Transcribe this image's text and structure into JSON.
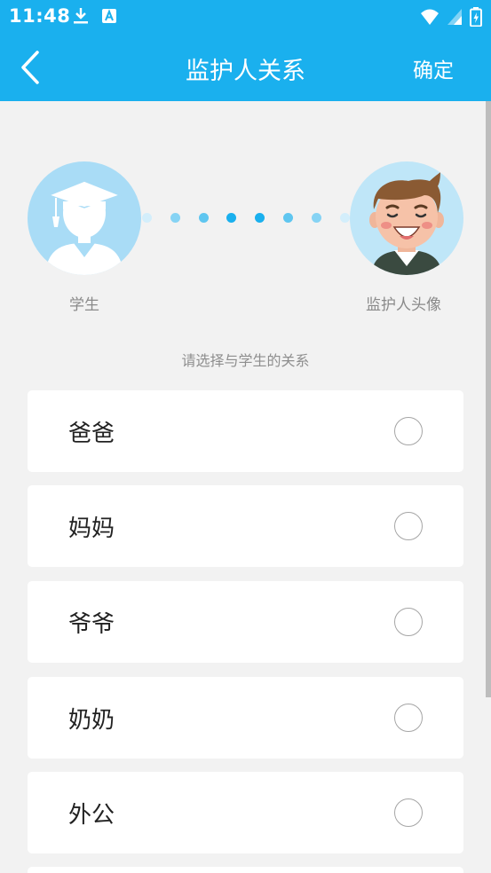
{
  "status": {
    "time": "11:48",
    "icons": [
      "download-icon",
      "a-icon",
      "wifi-icon",
      "signal-icon",
      "battery-icon"
    ]
  },
  "appbar": {
    "title": "监护人关系",
    "confirm": "确定"
  },
  "header": {
    "student_label": "学生",
    "guardian_label": "监护人头像",
    "hint": "请选择与学生的关系"
  },
  "options": [
    {
      "label": "爸爸",
      "selected": false
    },
    {
      "label": "妈妈",
      "selected": false
    },
    {
      "label": "爷爷",
      "selected": false
    },
    {
      "label": "奶奶",
      "selected": false
    },
    {
      "label": "外公",
      "selected": false
    }
  ],
  "colors": {
    "primary": "#1ab0ee",
    "background": "#f2f2f2",
    "dot_dark": "#1ab0ee",
    "dot_mid": "#5fc6f0",
    "dot_light": "#b7e3f7"
  }
}
